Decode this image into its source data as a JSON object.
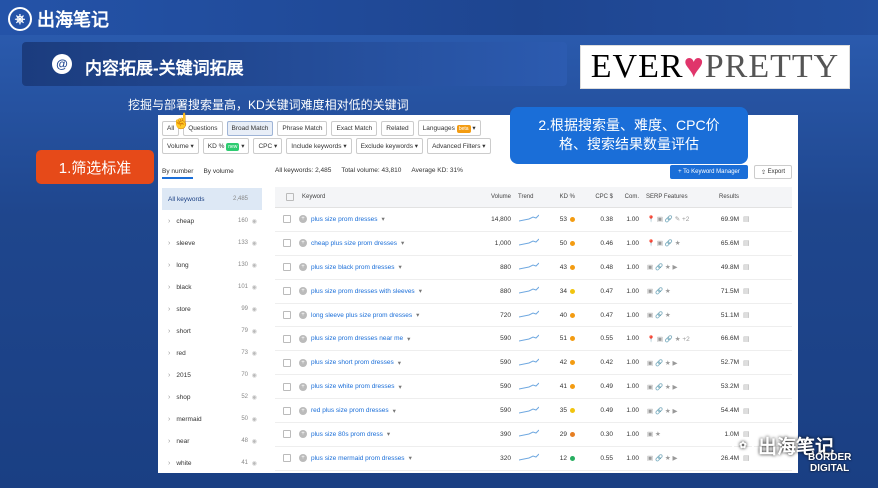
{
  "header": {
    "logo_text": "出海笔记",
    "logo_icon": "ship-wheel-icon"
  },
  "slide": {
    "title": "内容拓展-关键词拓展",
    "title_icon": "at-icon",
    "subtitle": "挖掘与部署搜索量高，KD关键词难度相对低的关键词",
    "brand": {
      "part1": "EVER",
      "heart": "♥",
      "part2": "PRETTY"
    }
  },
  "callouts": {
    "c1": "1.筛选标准",
    "c2_line1": "2.根据搜索量、难度、CPC价",
    "c2_line2": "格、搜索结果数量评估"
  },
  "toolbar": {
    "tabs": [
      "All",
      "Questions",
      "Broad Match",
      "Phrase Match",
      "Exact Match",
      "Related"
    ],
    "active_tab": "Broad Match",
    "languages": "Languages",
    "beta": "beta"
  },
  "filters": {
    "volume": "Volume",
    "kd": "KD %",
    "new_badge": "new",
    "cpc": "CPC",
    "include": "Include keywords",
    "exclude": "Exclude keywords",
    "advanced": "Advanced Filters"
  },
  "sidebar": {
    "tab_by_number": "By number",
    "tab_by_volume": "By volume",
    "items": [
      {
        "label": "All keywords",
        "count": "2,485"
      },
      {
        "label": "cheap",
        "count": "160"
      },
      {
        "label": "sleeve",
        "count": "133"
      },
      {
        "label": "long",
        "count": "130"
      },
      {
        "label": "black",
        "count": "101"
      },
      {
        "label": "store",
        "count": "99"
      },
      {
        "label": "short",
        "count": "79"
      },
      {
        "label": "red",
        "count": "73"
      },
      {
        "label": "2015",
        "count": "70"
      },
      {
        "label": "shop",
        "count": "52"
      },
      {
        "label": "mermaid",
        "count": "50"
      },
      {
        "label": "near",
        "count": "48"
      },
      {
        "label": "white",
        "count": "41"
      }
    ]
  },
  "stats": {
    "all": "All keywords: 2,485",
    "volume": "Total volume: 43,810",
    "kd": "Average KD: 31%"
  },
  "buttons": {
    "keyword_manager": "+ To Keyword Manager",
    "export": "Export"
  },
  "table": {
    "headers": [
      "Keyword",
      "Volume",
      "Trend",
      "KD %",
      "CPC $",
      "Com.",
      "SERP Features",
      "Results"
    ],
    "rows": [
      {
        "keyword": "plus size prom dresses",
        "volume": "14,800",
        "kd": "53",
        "kd_color": "#f39c12",
        "cpc": "0.38",
        "com": "1.00",
        "serp": "📍 ▣ 🔗 ✎ +2",
        "results": "69.9M"
      },
      {
        "keyword": "cheap plus size prom dresses",
        "volume": "1,000",
        "kd": "50",
        "kd_color": "#f39c12",
        "cpc": "0.46",
        "com": "1.00",
        "serp": "📍 ▣ 🔗 ★",
        "results": "65.6M"
      },
      {
        "keyword": "plus size black prom dresses",
        "volume": "880",
        "kd": "43",
        "kd_color": "#f39c12",
        "cpc": "0.48",
        "com": "1.00",
        "serp": "▣ 🔗 ★ ▶",
        "results": "49.8M"
      },
      {
        "keyword": "plus size prom dresses with sleeves",
        "volume": "880",
        "kd": "34",
        "kd_color": "#f1c40f",
        "cpc": "0.47",
        "com": "1.00",
        "serp": "▣ 🔗 ★",
        "results": "71.5M"
      },
      {
        "keyword": "long sleeve plus size prom dresses",
        "volume": "720",
        "kd": "40",
        "kd_color": "#f39c12",
        "cpc": "0.47",
        "com": "1.00",
        "serp": "▣ 🔗 ★",
        "results": "51.1M"
      },
      {
        "keyword": "plus size prom dresses near me",
        "volume": "590",
        "kd": "51",
        "kd_color": "#f39c12",
        "cpc": "0.55",
        "com": "1.00",
        "serp": "📍 ▣ 🔗 ★ +2",
        "results": "66.6M"
      },
      {
        "keyword": "plus size short prom dresses",
        "volume": "590",
        "kd": "42",
        "kd_color": "#f39c12",
        "cpc": "0.42",
        "com": "1.00",
        "serp": "▣ 🔗 ★ ▶",
        "results": "52.7M"
      },
      {
        "keyword": "plus size white prom dresses",
        "volume": "590",
        "kd": "41",
        "kd_color": "#f39c12",
        "cpc": "0.49",
        "com": "1.00",
        "serp": "▣ 🔗 ★ ▶",
        "results": "53.2M"
      },
      {
        "keyword": "red plus size prom dresses",
        "volume": "590",
        "kd": "35",
        "kd_color": "#f1c40f",
        "cpc": "0.49",
        "com": "1.00",
        "serp": "▣ 🔗 ★ ▶",
        "results": "54.4M"
      },
      {
        "keyword": "plus size 80s prom dress",
        "volume": "390",
        "kd": "29",
        "kd_color": "#e67e22",
        "cpc": "0.30",
        "com": "1.00",
        "serp": "▣ ★",
        "results": "1.0M"
      },
      {
        "keyword": "plus size mermaid prom dresses",
        "volume": "320",
        "kd": "12",
        "kd_color": "#27ae60",
        "cpc": "0.55",
        "com": "1.00",
        "serp": "▣ 🔗 ★ ▶",
        "results": "26.4M"
      }
    ]
  },
  "watermark": {
    "text": "出海笔记",
    "border1": "BORDER",
    "border2": "DIGITAL"
  }
}
